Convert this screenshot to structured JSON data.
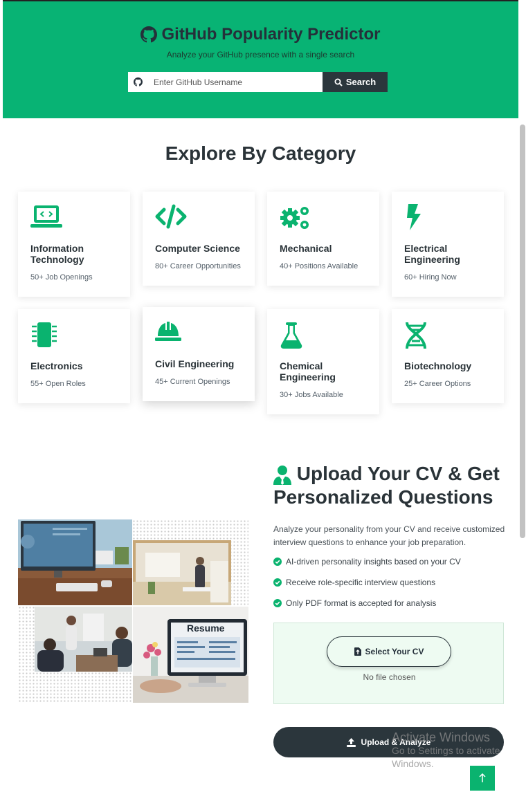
{
  "header": {
    "title": "GitHub Popularity Predictor",
    "subtitle": "Analyze your GitHub presence with a single search",
    "search_placeholder": "Enter GitHub Username",
    "search_button": "Search",
    "bg_color": "#08b374"
  },
  "categories": {
    "title": "Explore By Category",
    "items": [
      {
        "title": "Information Technology",
        "subtitle": "50+ Job Openings",
        "icon": "laptop-code-icon"
      },
      {
        "title": "Computer Science",
        "subtitle": "80+ Career Opportunities",
        "icon": "code-icon"
      },
      {
        "title": "Mechanical",
        "subtitle": "40+ Positions Available",
        "icon": "gears-icon"
      },
      {
        "title": "Electrical Engineering",
        "subtitle": "60+ Hiring Now",
        "icon": "bolt-icon"
      },
      {
        "title": "Electronics",
        "subtitle": "55+ Open Roles",
        "icon": "microchip-icon"
      },
      {
        "title": "Civil Engineering",
        "subtitle": "45+ Current Openings",
        "icon": "helmet-icon"
      },
      {
        "title": "Chemical Engineering",
        "subtitle": "30+ Jobs Available",
        "icon": "flask-icon"
      },
      {
        "title": "Biotechnology",
        "subtitle": "25+ Career Options",
        "icon": "dna-icon"
      }
    ]
  },
  "cv": {
    "title": "Upload Your CV & Get Personalized Questions",
    "description": "Analyze your personality from your CV and receive customized interview questions to enhance your job preparation.",
    "points": [
      "AI-driven personality insights based on your CV",
      "Receive role-specific interview questions",
      "Only PDF format is accepted for analysis"
    ],
    "select_button": "Select Your CV",
    "no_file": "No file chosen",
    "analyze_button": "Upload & Analyze",
    "collage_resume_label": "Resume"
  },
  "watermark": {
    "line1": "Activate Windows",
    "line2": "Go to Settings to activate",
    "line3": "Windows."
  },
  "accent_color": "#0ab36f"
}
